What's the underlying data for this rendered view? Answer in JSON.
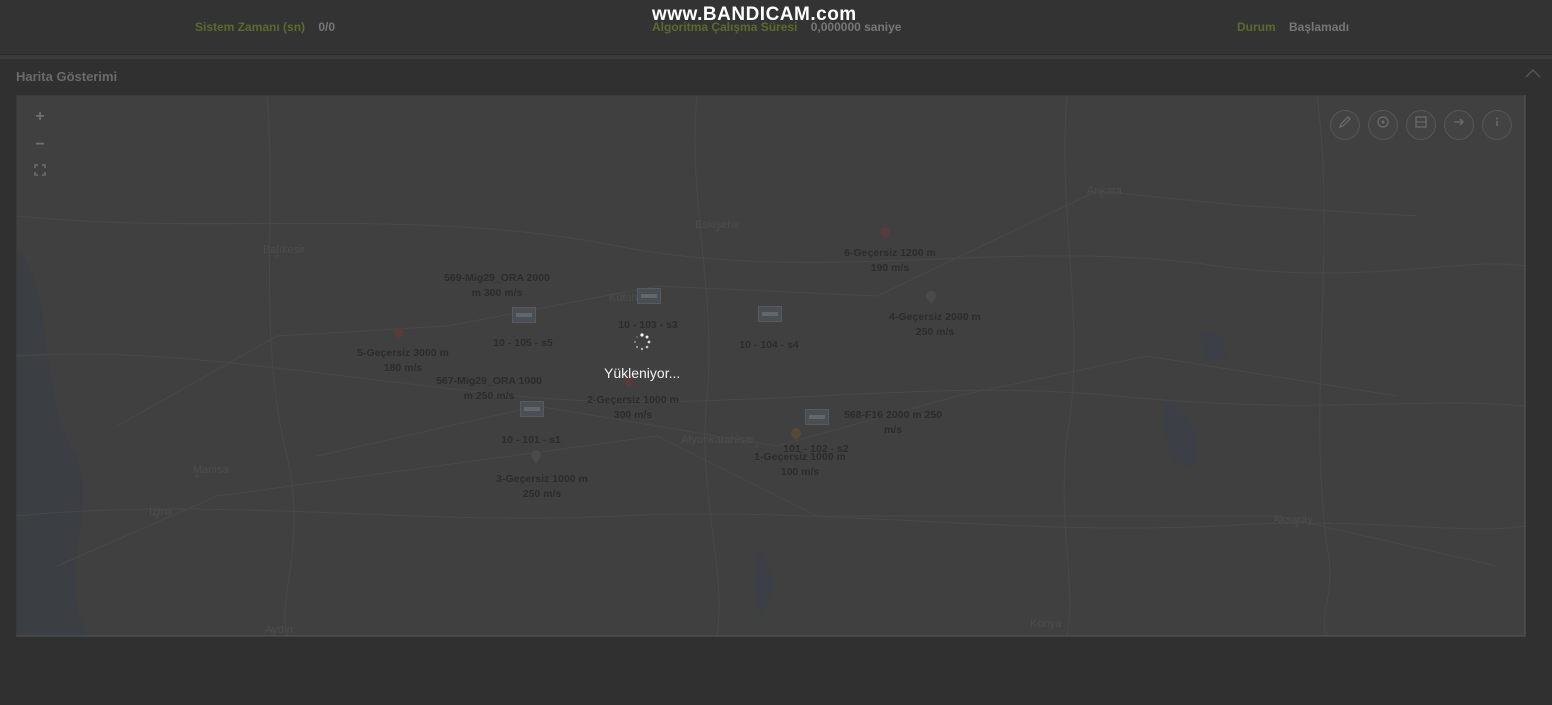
{
  "watermark": "www.BANDICAM.com",
  "status_bar": {
    "items": [
      {
        "label": "Sistem Zamanı (sn)",
        "value": "0/0"
      },
      {
        "label": "Algoritma Çalışma Süresi",
        "value": "0,000000 saniye"
      },
      {
        "label": "Durum",
        "value": "Başlamadı"
      }
    ]
  },
  "panel": {
    "title": "Harita Gösterimi",
    "collapse_icon": "chevron-up-icon"
  },
  "map": {
    "zoom_in": "+",
    "zoom_out": "−",
    "fullscreen_icon": "expand-icon",
    "tools": [
      "pencil-icon",
      "target-icon",
      "layers-icon",
      "arrow-right-icon",
      "info-icon"
    ],
    "cities": [
      "Balıkesir",
      "Eskişehir",
      "Kütahya",
      "Afyonkarahisar",
      "Manisa",
      "İzmir",
      "Ankara",
      "Aksaray",
      "Konya",
      "Aydın"
    ],
    "markers": [
      {
        "lines": [
          "569-Mig29_ORA 2000",
          "m 300 m/s"
        ],
        "kind": "label"
      },
      {
        "lines": [
          "10 - 105 - s5"
        ],
        "kind": "flag"
      },
      {
        "lines": [
          "5-Geçersiz 3000 m",
          "180 m/s"
        ],
        "kind": "pin"
      },
      {
        "lines": [
          "567-Mig29_ORA 1000",
          "m 250 m/s"
        ],
        "kind": "label"
      },
      {
        "lines": [
          "10 - 101 - s1"
        ],
        "kind": "flag"
      },
      {
        "lines": [
          "2-Geçersiz 1000 m",
          "300 m/s"
        ],
        "kind": "pin"
      },
      {
        "lines": [
          "3-Geçersiz 1000 m",
          "250 m/s"
        ],
        "kind": "pin"
      },
      {
        "lines": [
          "10 - 104 - s4"
        ],
        "kind": "flag"
      },
      {
        "lines": [
          "6-Geçersiz 1200 m",
          "190 m/s"
        ],
        "kind": "pin"
      },
      {
        "lines": [
          "4-Geçersiz 2000 m",
          "250 m/s"
        ],
        "kind": "pin"
      },
      {
        "lines": [
          "568-F16 2000 m 250",
          "m/s"
        ],
        "kind": "label"
      },
      {
        "lines": [
          "101 - 102 - s2"
        ],
        "kind": "flag"
      },
      {
        "lines": [
          "1-Geçersiz 1000 m",
          "100 m/s"
        ],
        "kind": "pin"
      },
      {
        "lines": [
          "10 - 103 - s3"
        ],
        "kind": "flag"
      }
    ]
  },
  "loading": {
    "text": "Yükleniyor...",
    "icon": "spinner-icon"
  }
}
